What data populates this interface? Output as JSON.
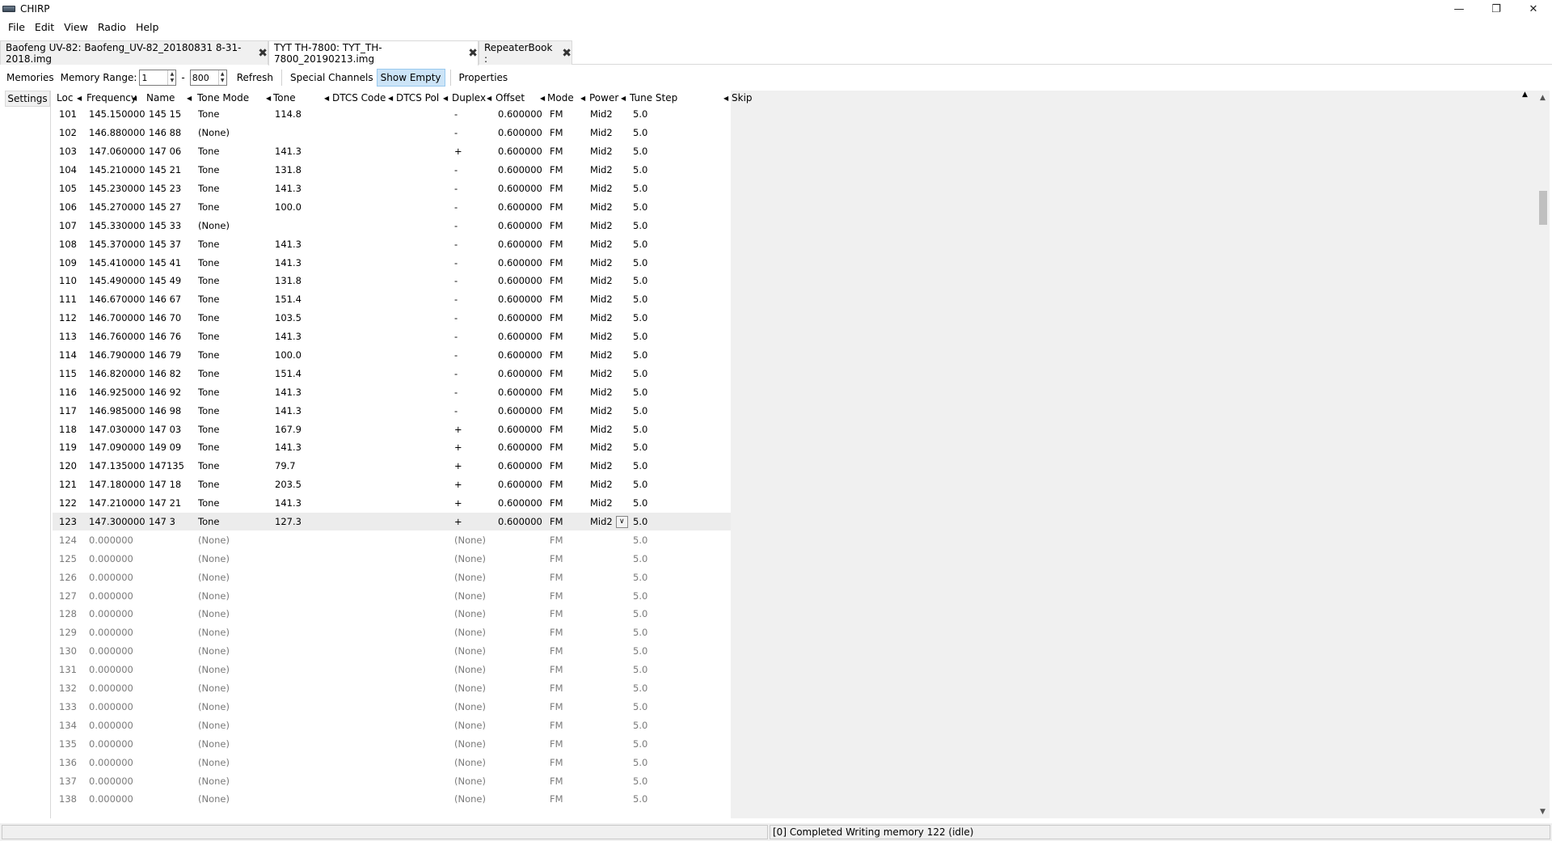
{
  "window": {
    "title": "CHIRP",
    "minimize": "—",
    "maximize": "❐",
    "close": "✕"
  },
  "menu": [
    "File",
    "Edit",
    "View",
    "Radio",
    "Help"
  ],
  "tabs": [
    {
      "label": "Baofeng UV-82: Baofeng_UV-82_20180831 8-31-2018.img",
      "active": false
    },
    {
      "label": "TYT TH-7800: TYT_TH-7800_20190213.img",
      "active": true
    },
    {
      "label": "RepeaterBook :",
      "active": false
    }
  ],
  "tab_close_glyph": "✖",
  "toolbar": {
    "memories_label": "Memories",
    "range_label": "Memory Range:",
    "range_start": "1",
    "range_dash": "-",
    "range_end": "800",
    "refresh": "Refresh",
    "special_channels": "Special Channels",
    "show_empty": "Show Empty",
    "properties": "Properties"
  },
  "sidebar": {
    "settings_label": "Settings"
  },
  "columns": [
    {
      "label": "Loc",
      "sort": true
    },
    {
      "label": "Frequency",
      "sort": true
    },
    {
      "label": "Name",
      "sort": true
    },
    {
      "label": "Tone Mode",
      "sort": true
    },
    {
      "label": "Tone",
      "sort": true
    },
    {
      "label": "DTCS Code",
      "sort": true
    },
    {
      "label": "DTCS Pol",
      "sort": true
    },
    {
      "label": "Duplex",
      "sort": true
    },
    {
      "label": "Offset",
      "sort": true
    },
    {
      "label": "Mode",
      "sort": true
    },
    {
      "label": "Power",
      "sort": true
    },
    {
      "label": "Tune Step",
      "sort": true
    },
    {
      "label": "Skip",
      "sort": false
    }
  ],
  "rows": [
    [
      "101",
      "145.150000",
      "145 15",
      "Tone",
      "114.8",
      "",
      "",
      "-",
      "0.600000",
      "FM",
      "Mid2",
      "5.0",
      ""
    ],
    [
      "102",
      "146.880000",
      "146 88",
      "(None)",
      "",
      "",
      "",
      "-",
      "0.600000",
      "FM",
      "Mid2",
      "5.0",
      ""
    ],
    [
      "103",
      "147.060000",
      "147 06",
      "Tone",
      "141.3",
      "",
      "",
      "+",
      "0.600000",
      "FM",
      "Mid2",
      "5.0",
      ""
    ],
    [
      "104",
      "145.210000",
      "145 21",
      "Tone",
      "131.8",
      "",
      "",
      "-",
      "0.600000",
      "FM",
      "Mid2",
      "5.0",
      ""
    ],
    [
      "105",
      "145.230000",
      "145 23",
      "Tone",
      "141.3",
      "",
      "",
      "-",
      "0.600000",
      "FM",
      "Mid2",
      "5.0",
      ""
    ],
    [
      "106",
      "145.270000",
      "145 27",
      "Tone",
      "100.0",
      "",
      "",
      "-",
      "0.600000",
      "FM",
      "Mid2",
      "5.0",
      ""
    ],
    [
      "107",
      "145.330000",
      "145 33",
      "(None)",
      "",
      "",
      "",
      "-",
      "0.600000",
      "FM",
      "Mid2",
      "5.0",
      ""
    ],
    [
      "108",
      "145.370000",
      "145 37",
      "Tone",
      "141.3",
      "",
      "",
      "-",
      "0.600000",
      "FM",
      "Mid2",
      "5.0",
      ""
    ],
    [
      "109",
      "145.410000",
      "145 41",
      "Tone",
      "141.3",
      "",
      "",
      "-",
      "0.600000",
      "FM",
      "Mid2",
      "5.0",
      ""
    ],
    [
      "110",
      "145.490000",
      "145 49",
      "Tone",
      "131.8",
      "",
      "",
      "-",
      "0.600000",
      "FM",
      "Mid2",
      "5.0",
      ""
    ],
    [
      "111",
      "146.670000",
      "146 67",
      "Tone",
      "151.4",
      "",
      "",
      "-",
      "0.600000",
      "FM",
      "Mid2",
      "5.0",
      ""
    ],
    [
      "112",
      "146.700000",
      "146 70",
      "Tone",
      "103.5",
      "",
      "",
      "-",
      "0.600000",
      "FM",
      "Mid2",
      "5.0",
      ""
    ],
    [
      "113",
      "146.760000",
      "146 76",
      "Tone",
      "141.3",
      "",
      "",
      "-",
      "0.600000",
      "FM",
      "Mid2",
      "5.0",
      ""
    ],
    [
      "114",
      "146.790000",
      "146 79",
      "Tone",
      "100.0",
      "",
      "",
      "-",
      "0.600000",
      "FM",
      "Mid2",
      "5.0",
      ""
    ],
    [
      "115",
      "146.820000",
      "146 82",
      "Tone",
      "151.4",
      "",
      "",
      "-",
      "0.600000",
      "FM",
      "Mid2",
      "5.0",
      ""
    ],
    [
      "116",
      "146.925000",
      "146 92",
      "Tone",
      "141.3",
      "",
      "",
      "-",
      "0.600000",
      "FM",
      "Mid2",
      "5.0",
      ""
    ],
    [
      "117",
      "146.985000",
      "146 98",
      "Tone",
      "141.3",
      "",
      "",
      "-",
      "0.600000",
      "FM",
      "Mid2",
      "5.0",
      ""
    ],
    [
      "118",
      "147.030000",
      "147 03",
      "Tone",
      "167.9",
      "",
      "",
      "+",
      "0.600000",
      "FM",
      "Mid2",
      "5.0",
      ""
    ],
    [
      "119",
      "147.090000",
      "149 09",
      "Tone",
      "141.3",
      "",
      "",
      "+",
      "0.600000",
      "FM",
      "Mid2",
      "5.0",
      ""
    ],
    [
      "120",
      "147.135000",
      "147135",
      "Tone",
      "79.7",
      "",
      "",
      "+",
      "0.600000",
      "FM",
      "Mid2",
      "5.0",
      ""
    ],
    [
      "121",
      "147.180000",
      "147 18",
      "Tone",
      "203.5",
      "",
      "",
      "+",
      "0.600000",
      "FM",
      "Mid2",
      "5.0",
      ""
    ],
    [
      "122",
      "147.210000",
      "147 21",
      "Tone",
      "141.3",
      "",
      "",
      "+",
      "0.600000",
      "FM",
      "Mid2",
      "5.0",
      ""
    ],
    [
      "123",
      "147.300000",
      "147 3",
      "Tone",
      "127.3",
      "",
      "",
      "+",
      "0.600000",
      "FM",
      "Mid2",
      "5.0",
      ""
    ],
    [
      "124",
      "0.000000",
      "",
      "(None)",
      "",
      "",
      "",
      "(None)",
      "",
      "FM",
      "",
      "5.0",
      ""
    ],
    [
      "125",
      "0.000000",
      "",
      "(None)",
      "",
      "",
      "",
      "(None)",
      "",
      "FM",
      "",
      "5.0",
      ""
    ],
    [
      "126",
      "0.000000",
      "",
      "(None)",
      "",
      "",
      "",
      "(None)",
      "",
      "FM",
      "",
      "5.0",
      ""
    ],
    [
      "127",
      "0.000000",
      "",
      "(None)",
      "",
      "",
      "",
      "(None)",
      "",
      "FM",
      "",
      "5.0",
      ""
    ],
    [
      "128",
      "0.000000",
      "",
      "(None)",
      "",
      "",
      "",
      "(None)",
      "",
      "FM",
      "",
      "5.0",
      ""
    ],
    [
      "129",
      "0.000000",
      "",
      "(None)",
      "",
      "",
      "",
      "(None)",
      "",
      "FM",
      "",
      "5.0",
      ""
    ],
    [
      "130",
      "0.000000",
      "",
      "(None)",
      "",
      "",
      "",
      "(None)",
      "",
      "FM",
      "",
      "5.0",
      ""
    ],
    [
      "131",
      "0.000000",
      "",
      "(None)",
      "",
      "",
      "",
      "(None)",
      "",
      "FM",
      "",
      "5.0",
      ""
    ],
    [
      "132",
      "0.000000",
      "",
      "(None)",
      "",
      "",
      "",
      "(None)",
      "",
      "FM",
      "",
      "5.0",
      ""
    ],
    [
      "133",
      "0.000000",
      "",
      "(None)",
      "",
      "",
      "",
      "(None)",
      "",
      "FM",
      "",
      "5.0",
      ""
    ],
    [
      "134",
      "0.000000",
      "",
      "(None)",
      "",
      "",
      "",
      "(None)",
      "",
      "FM",
      "",
      "5.0",
      ""
    ],
    [
      "135",
      "0.000000",
      "",
      "(None)",
      "",
      "",
      "",
      "(None)",
      "",
      "FM",
      "",
      "5.0",
      ""
    ],
    [
      "136",
      "0.000000",
      "",
      "(None)",
      "",
      "",
      "",
      "(None)",
      "",
      "FM",
      "",
      "5.0",
      ""
    ],
    [
      "137",
      "0.000000",
      "",
      "(None)",
      "",
      "",
      "",
      "(None)",
      "",
      "FM",
      "",
      "5.0",
      ""
    ],
    [
      "138",
      "0.000000",
      "",
      "(None)",
      "",
      "",
      "",
      "(None)",
      "",
      "FM",
      "",
      "5.0",
      ""
    ]
  ],
  "selected_loc": "123",
  "empty_from_loc": "124",
  "dropdown_glyph": "∨",
  "status": {
    "left": "",
    "right": "[0] Completed Writing memory 122 (idle)"
  },
  "colors": {
    "selected_row": "#ececec",
    "pressed_button": "#cce4f7",
    "empty_text": "#7a7a7a"
  }
}
